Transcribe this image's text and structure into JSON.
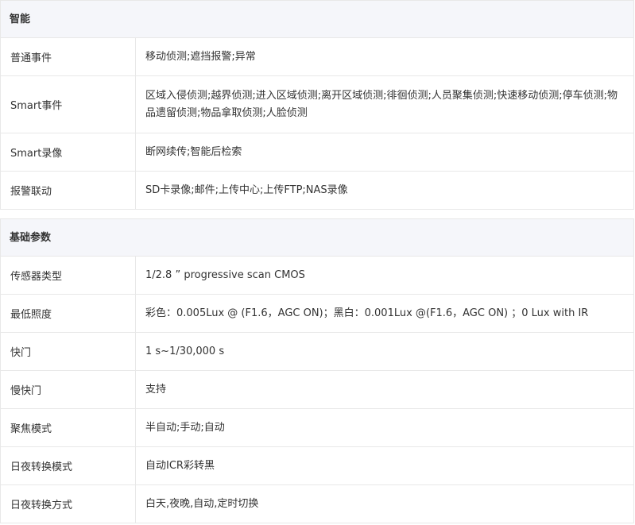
{
  "sections": [
    {
      "title": "智能",
      "rows": [
        {
          "label": "普通事件",
          "value": "移动侦测;遮挡报警;异常"
        },
        {
          "label": "Smart事件",
          "value": "区域入侵侦测;越界侦测;进入区域侦测;离开区域侦测;徘徊侦测;人员聚集侦测;快速移动侦测;停车侦测;物品遗留侦测;物品拿取侦测;人脸侦测"
        },
        {
          "label": "Smart录像",
          "value": "断网续传;智能后检索"
        },
        {
          "label": "报警联动",
          "value": "SD卡录像;邮件;上传中心;上传FTP;NAS录像"
        }
      ]
    },
    {
      "title": "基础参数",
      "rows": [
        {
          "label": "传感器类型",
          "value": "1/2.8 ” progressive scan CMOS"
        },
        {
          "label": "最低照度",
          "value": "彩色：0.005Lux @ (F1.6，AGC ON)；黑白：0.001Lux @(F1.6，AGC ON) ；0 Lux with IR"
        },
        {
          "label": "快门",
          "value": "1 s~1/30,000 s"
        },
        {
          "label": "慢快门",
          "value": "支持"
        },
        {
          "label": "聚焦模式",
          "value": "半自动;手动;自动"
        },
        {
          "label": "日夜转换模式",
          "value": "自动ICR彩转黑"
        },
        {
          "label": "日夜转换方式",
          "value": "白天,夜晚,自动,定时切换"
        }
      ]
    }
  ]
}
